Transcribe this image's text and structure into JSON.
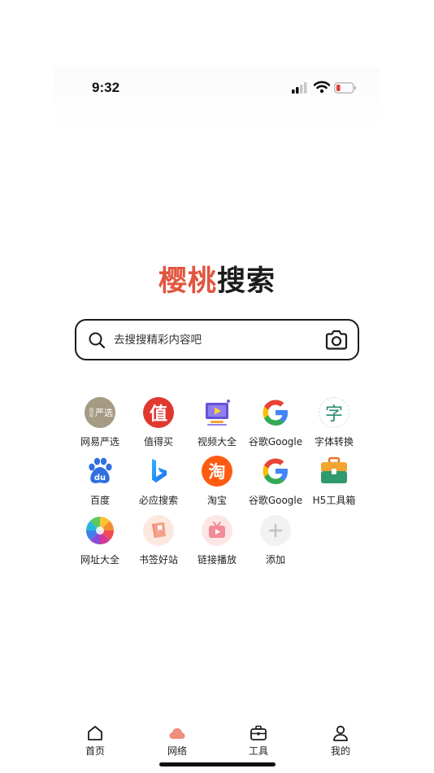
{
  "status_bar": {
    "time": "9:32"
  },
  "brand": {
    "part1": "樱桃",
    "part2": "搜索"
  },
  "search": {
    "placeholder": "去搜搜精彩内容吧"
  },
  "shortcuts": [
    {
      "label": "网易严选",
      "icon": "netease-yanxuan-icon"
    },
    {
      "label": "值得买",
      "icon": "zhidemai-icon"
    },
    {
      "label": "视频大全",
      "icon": "video-icon"
    },
    {
      "label": "谷歌Google",
      "icon": "google-icon"
    },
    {
      "label": "字体转换",
      "icon": "font-convert-icon"
    },
    {
      "label": "百度",
      "icon": "baidu-icon"
    },
    {
      "label": "必应搜索",
      "icon": "bing-icon"
    },
    {
      "label": "淘宝",
      "icon": "taobao-icon"
    },
    {
      "label": "谷歌Google",
      "icon": "google-icon"
    },
    {
      "label": "H5工具箱",
      "icon": "toolbox-icon"
    },
    {
      "label": "网址大全",
      "icon": "pinwheel-icon"
    },
    {
      "label": "书签好站",
      "icon": "bookmark-icon"
    },
    {
      "label": "链接播放",
      "icon": "tv-play-icon"
    },
    {
      "label": "添加",
      "icon": "add-icon"
    }
  ],
  "icon_text": {
    "yanxuan_small": "网易",
    "yanxuan_big": "严选",
    "zhi": "值",
    "zi": "字",
    "du": "du",
    "tao": "淘"
  },
  "tabs": [
    {
      "label": "首页",
      "icon": "home-icon"
    },
    {
      "label": "网络",
      "icon": "cloud-icon",
      "active": true
    },
    {
      "label": "工具",
      "icon": "briefcase-icon"
    },
    {
      "label": "我的",
      "icon": "user-icon"
    }
  ],
  "colors": {
    "brand_red": "#e2553e",
    "text_dark": "#1b1b1b"
  }
}
